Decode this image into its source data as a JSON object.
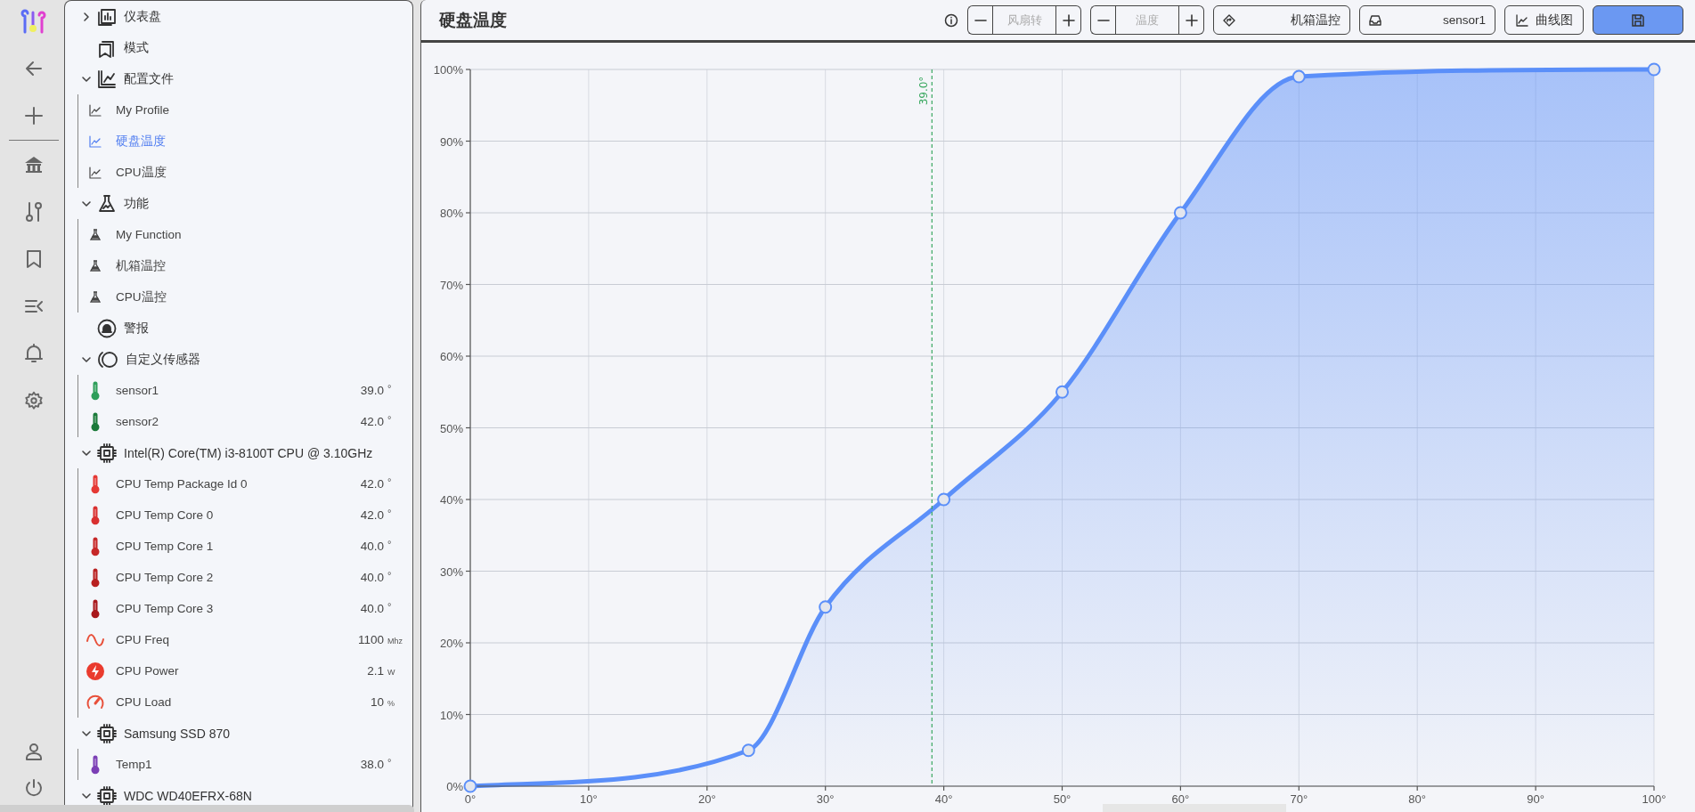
{
  "sidebar": {
    "items": [
      {
        "kind": "dashboard",
        "label": "仪表盘",
        "expanded": false,
        "selected": false
      },
      {
        "kind": "mode",
        "label": "模式",
        "selected": false
      },
      {
        "kind": "profiles",
        "label": "配置文件",
        "expanded": true,
        "selected": false,
        "children": [
          {
            "kind": "profile",
            "label": "My Profile",
            "selected": false
          },
          {
            "kind": "profile",
            "label": "硬盘温度",
            "selected": true
          },
          {
            "kind": "profile",
            "label": "CPU温度",
            "selected": false
          }
        ]
      },
      {
        "kind": "functions",
        "label": "功能",
        "expanded": true,
        "selected": false,
        "children": [
          {
            "kind": "function",
            "label": "My Function",
            "selected": false
          },
          {
            "kind": "function",
            "label": "机箱温控",
            "selected": false
          },
          {
            "kind": "function",
            "label": "CPU温控",
            "selected": false
          }
        ]
      },
      {
        "kind": "alarm",
        "label": "警报",
        "selected": false
      },
      {
        "kind": "sensors",
        "label": "自定义传感器",
        "expanded": true,
        "selected": false,
        "children": [
          {
            "kind": "temp",
            "label": "sensor1",
            "value": "39.0",
            "unit": "°",
            "color": "#2e9e5a",
            "selected": false
          },
          {
            "kind": "temp",
            "label": "sensor2",
            "value": "42.0",
            "unit": "°",
            "color": "#1b7a3a",
            "selected": false
          }
        ]
      },
      {
        "kind": "chip",
        "label": "Intel(R) Core(TM) i3-8100T CPU @ 3.10GHz",
        "expanded": true,
        "selected": false,
        "children": [
          {
            "kind": "temp",
            "label": "CPU Temp Package Id 0",
            "value": "42.0",
            "unit": "°",
            "color": "#e53935",
            "selected": false
          },
          {
            "kind": "temp",
            "label": "CPU Temp Core 0",
            "value": "42.0",
            "unit": "°",
            "color": "#d93030",
            "selected": false
          },
          {
            "kind": "temp",
            "label": "CPU Temp Core 1",
            "value": "40.0",
            "unit": "°",
            "color": "#c62828",
            "selected": false
          },
          {
            "kind": "temp",
            "label": "CPU Temp Core 2",
            "value": "40.0",
            "unit": "°",
            "color": "#b82020",
            "selected": false
          },
          {
            "kind": "temp",
            "label": "CPU Temp Core 3",
            "value": "40.0",
            "unit": "°",
            "color": "#a8181c",
            "selected": false
          },
          {
            "kind": "freq",
            "label": "CPU Freq",
            "value": "1100",
            "unit": "Mhz",
            "selected": false
          },
          {
            "kind": "power",
            "label": "CPU Power",
            "value": "2.1",
            "unit": "W",
            "selected": false
          },
          {
            "kind": "load",
            "label": "CPU Load",
            "value": "10",
            "unit": "%",
            "selected": false
          }
        ]
      },
      {
        "kind": "chip",
        "label": "Samsung SSD 870",
        "expanded": true,
        "selected": false,
        "children": [
          {
            "kind": "temp",
            "label": "Temp1",
            "value": "38.0",
            "unit": "°",
            "color": "#7b3fb5",
            "selected": false
          }
        ]
      },
      {
        "kind": "chip",
        "label": "WDC WD40EFRX-68N",
        "expanded": true,
        "selected": false
      }
    ]
  },
  "header": {
    "title": "硬盘温度",
    "fan_speed": {
      "placeholder": "风扇转"
    },
    "temperature": {
      "placeholder": "温度"
    },
    "function_select": {
      "value": "机箱温控"
    },
    "sensor_select": {
      "value": "sensor1"
    },
    "chart_button": {
      "label": "曲线图"
    }
  },
  "chart": {
    "chart_data": {
      "type": "area",
      "x": [
        0,
        23.5,
        30,
        40,
        50,
        60,
        70,
        100
      ],
      "series": [
        {
          "color": "#5b8ff9",
          "values": [
            0,
            5,
            25,
            40,
            55,
            80,
            99,
            100
          ]
        }
      ],
      "xlim": [
        0,
        100
      ],
      "ylim": [
        0,
        100
      ],
      "xticks": [
        {
          "value": 0,
          "label": "0°"
        },
        {
          "value": 10,
          "label": "10°"
        },
        {
          "value": 20,
          "label": "20°"
        },
        {
          "value": 30,
          "label": "30°"
        },
        {
          "value": 40,
          "label": "40°"
        },
        {
          "value": 50,
          "label": "50°"
        },
        {
          "value": 60,
          "label": "60°"
        },
        {
          "value": 70,
          "label": "70°"
        },
        {
          "value": 80,
          "label": "80°"
        },
        {
          "value": 90,
          "label": "90°"
        },
        {
          "value": 100,
          "label": "100°"
        }
      ],
      "yticks": [
        {
          "value": 0,
          "label": "0%"
        },
        {
          "value": 10,
          "label": "10%"
        },
        {
          "value": 20,
          "label": "20%"
        },
        {
          "value": 30,
          "label": "30%"
        },
        {
          "value": 40,
          "label": "40%"
        },
        {
          "value": 50,
          "label": "50%"
        },
        {
          "value": 60,
          "label": "60%"
        },
        {
          "value": 70,
          "label": "70%"
        },
        {
          "value": 80,
          "label": "80%"
        },
        {
          "value": 90,
          "label": "90%"
        },
        {
          "value": 100,
          "label": "100%"
        }
      ],
      "grid": true,
      "ref_lines": [
        {
          "axis": "x",
          "value": 39,
          "label": "39.0°",
          "color": "#3aa860"
        }
      ]
    }
  }
}
